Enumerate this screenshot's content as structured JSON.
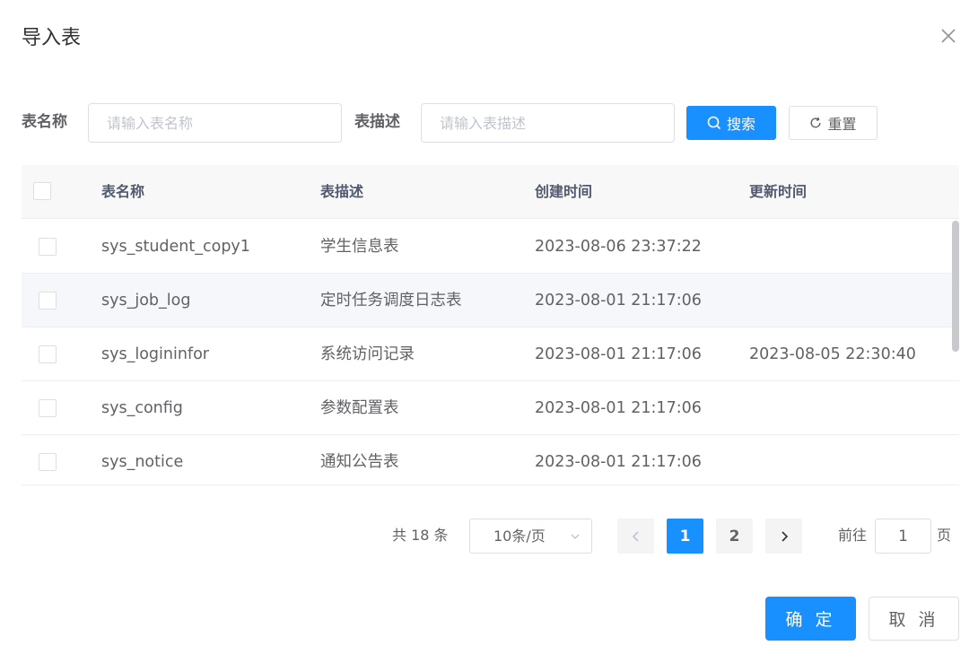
{
  "dialog": {
    "title": "导入表"
  },
  "search": {
    "table_name_label": "表名称",
    "table_name_placeholder": "请输入表名称",
    "table_desc_label": "表描述",
    "table_desc_placeholder": "请输入表描述",
    "search_button": "搜索",
    "reset_button": "重置"
  },
  "table": {
    "columns": [
      "表名称",
      "表描述",
      "创建时间",
      "更新时间"
    ],
    "rows": [
      {
        "name": "sys_student_copy1",
        "desc": "学生信息表",
        "created": "2023-08-06 23:37:22",
        "updated": ""
      },
      {
        "name": "sys_job_log",
        "desc": "定时任务调度日志表",
        "created": "2023-08-01 21:17:06",
        "updated": ""
      },
      {
        "name": "sys_logininfor",
        "desc": "系统访问记录",
        "created": "2023-08-01 21:17:06",
        "updated": "2023-08-05 22:30:40"
      },
      {
        "name": "sys_config",
        "desc": "参数配置表",
        "created": "2023-08-01 21:17:06",
        "updated": ""
      },
      {
        "name": "sys_notice",
        "desc": "通知公告表",
        "created": "2023-08-01 21:17:06",
        "updated": ""
      }
    ]
  },
  "pagination": {
    "total_text": "共 18 条",
    "page_size": "10条/页",
    "pages": [
      "1",
      "2"
    ],
    "current_page": "1",
    "goto_label": "前往",
    "goto_value": "1",
    "page_suffix": "页"
  },
  "footer": {
    "confirm": "确 定",
    "cancel": "取 消"
  },
  "colors": {
    "primary": "#1890ff",
    "border": "#dcdfe6",
    "header_bg": "#f8f8f9"
  },
  "icons": {
    "close": "close-icon",
    "search": "search-icon",
    "reset": "refresh-icon",
    "prev": "chevron-left-icon",
    "next": "chevron-right-icon",
    "dropdown": "chevron-down-icon"
  }
}
